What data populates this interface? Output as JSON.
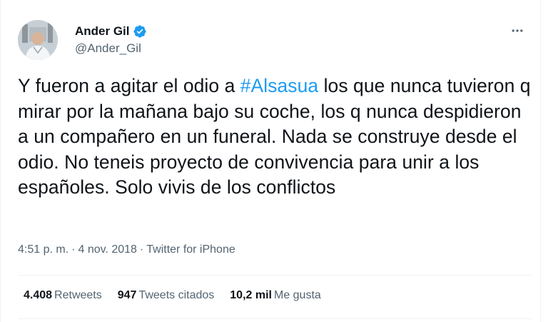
{
  "author": {
    "name": "Ander Gil",
    "handle": "@Ander_Gil",
    "verified": true
  },
  "tweet": {
    "text_before": "Y fueron a agitar el odio a ",
    "hashtag": "#Alsasua",
    "text_after": " los que nunca tuvieron q mirar por la mañana bajo su coche, los q nunca despidieron a un compañero en un funeral. Nada se construye desde el odio. No teneis proyecto de convivencia para unir a los españoles. Solo vivis de los conflictos"
  },
  "meta": {
    "time": "4:51 p. m.",
    "date": "4 nov. 2018",
    "source": "Twitter for iPhone",
    "separator": "·"
  },
  "stats": {
    "retweets_count": "4.408",
    "retweets_label": "Retweets",
    "quotes_count": "947",
    "quotes_label": "Tweets citados",
    "likes_count": "10,2 mil",
    "likes_label": "Me gusta"
  },
  "colors": {
    "accent": "#1d9bf0",
    "text_primary": "#0f1419",
    "text_secondary": "#536471",
    "divider": "#eff3f4"
  },
  "icons": {
    "verified": "verified-badge-icon",
    "more": "more-horizontal-icon"
  }
}
